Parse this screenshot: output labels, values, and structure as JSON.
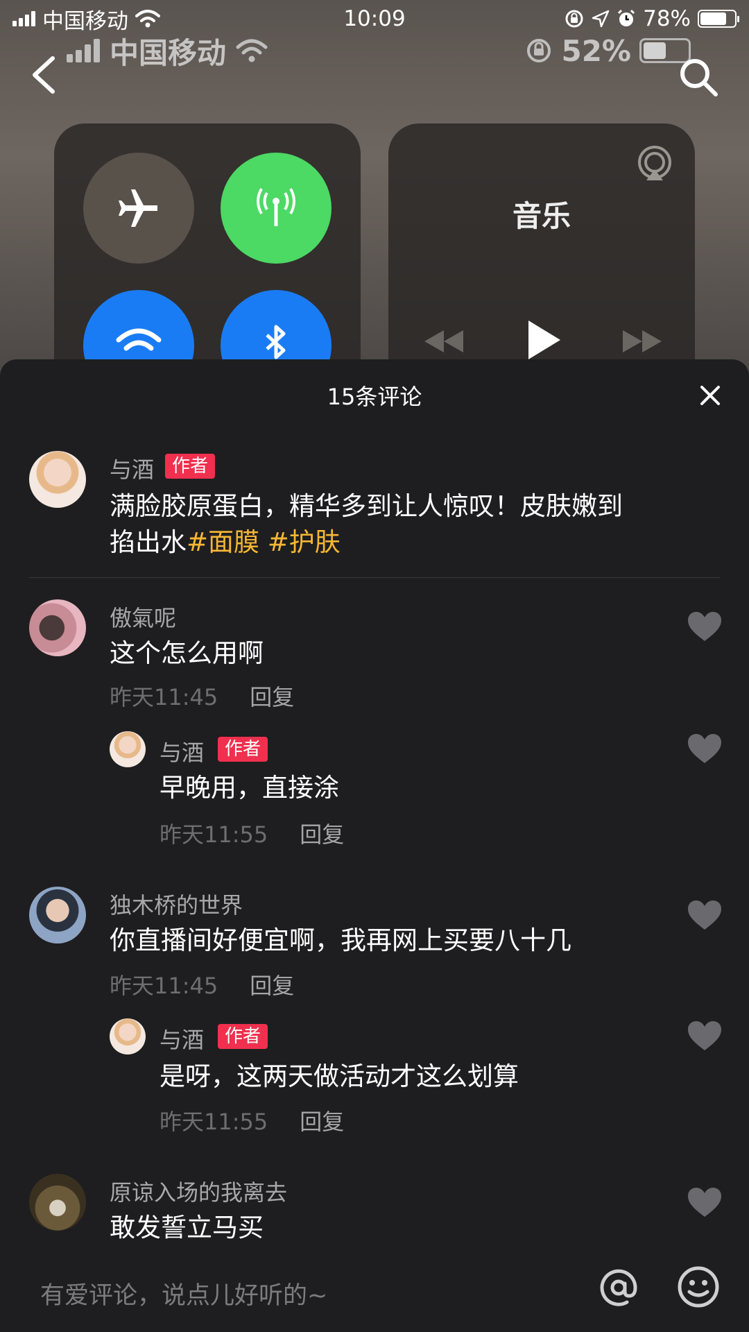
{
  "status_bar": {
    "carrier": "中国移动",
    "time": "10:09",
    "battery": "78%",
    "battery_level": 0.78
  },
  "video": {
    "inner_status": {
      "carrier": "中国移动",
      "battery": "52%",
      "battery_level": 0.52
    },
    "music_title": "音乐"
  },
  "comments_sheet": {
    "title": "15条评论",
    "author_post": {
      "username": "与酒",
      "badge": "作者",
      "text_line1": "满脸胶原蛋白，精华多到让人惊叹！皮肤嫩到",
      "text_line2_plain": "掐出水",
      "hashtag1": "#面膜",
      "hashtag2": "#护肤"
    },
    "comments": [
      {
        "username": "傲氣呢",
        "text": "这个怎么用啊",
        "time": "昨天11:45",
        "reply": "回复",
        "sub_reply": {
          "username": "与酒",
          "badge": "作者",
          "text": "早晚用，直接涂",
          "time": "昨天11:55",
          "reply": "回复"
        }
      },
      {
        "username": "独木桥的世界",
        "text": "你直播间好便宜啊，我再网上买要八十几",
        "time": "昨天11:45",
        "reply": "回复",
        "sub_reply": {
          "username": "与酒",
          "badge": "作者",
          "text": "是呀，这两天做活动才这么划算",
          "time": "昨天11:55",
          "reply": "回复"
        }
      },
      {
        "username": "原谅入场的我离去",
        "text": "敢发誓立马买"
      }
    ],
    "input": {
      "placeholder": "有爱评论，说点儿好听的~"
    }
  },
  "colors": {
    "badge": "#f0304e",
    "hashtag": "#f7b733",
    "sheet_bg": "#1e1e20",
    "green_toggle": "#4cd964",
    "blue_toggle": "#1a7cf5"
  }
}
